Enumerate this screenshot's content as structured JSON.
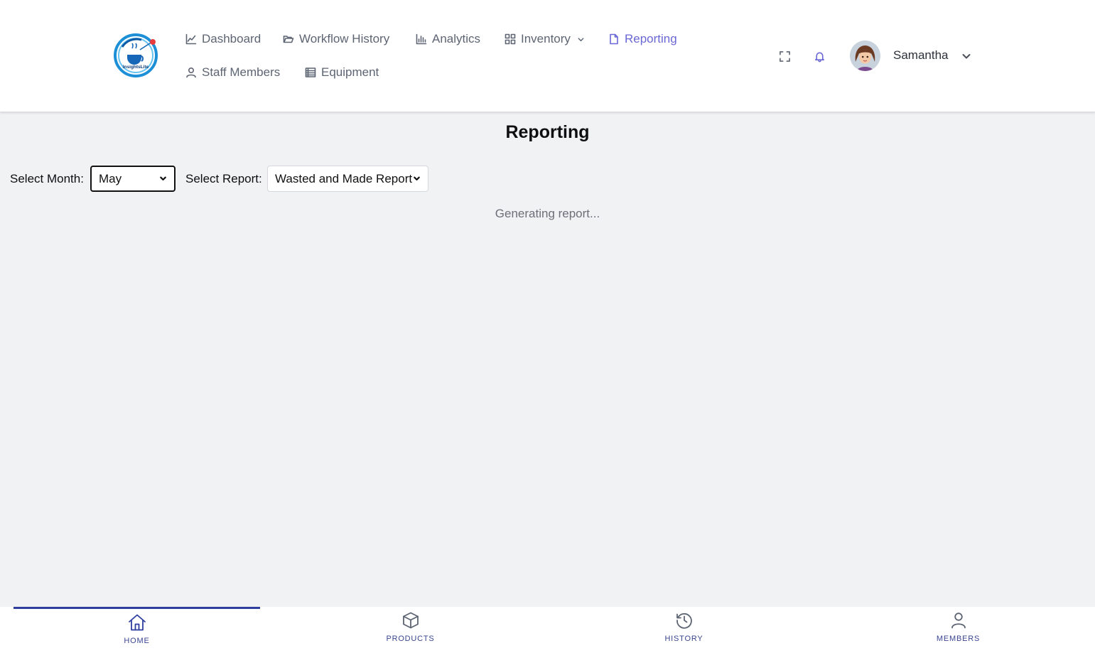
{
  "header": {
    "logo_text": "InsightsLite",
    "nav": {
      "dashboard": "Dashboard",
      "workflow_history": "Workflow History",
      "analytics": "Analytics",
      "inventory": "Inventory",
      "reporting": "Reporting",
      "staff_members": "Staff Members",
      "equipment": "Equipment"
    },
    "active_nav": "reporting",
    "icons": [
      "fullscreen-icon",
      "bell-icon"
    ],
    "user": {
      "name": "Samantha"
    }
  },
  "main": {
    "title": "Reporting",
    "month_label": "Select Month:",
    "month_value": "May",
    "report_label": "Select Report:",
    "report_value": "Wasted and Made Report",
    "status": "Generating report..."
  },
  "bottom_nav": {
    "items": [
      {
        "label": "HOME",
        "icon": "home-icon"
      },
      {
        "label": "PRODUCTS",
        "icon": "box-icon"
      },
      {
        "label": "HISTORY",
        "icon": "history-icon"
      },
      {
        "label": "MEMBERS",
        "icon": "user-icon"
      }
    ],
    "active": "HOME"
  },
  "colors": {
    "accent": "#6a67d6",
    "nav_text": "#5d6472",
    "bottom_accent": "#2f3fa0",
    "background": "#f1f2f4"
  }
}
